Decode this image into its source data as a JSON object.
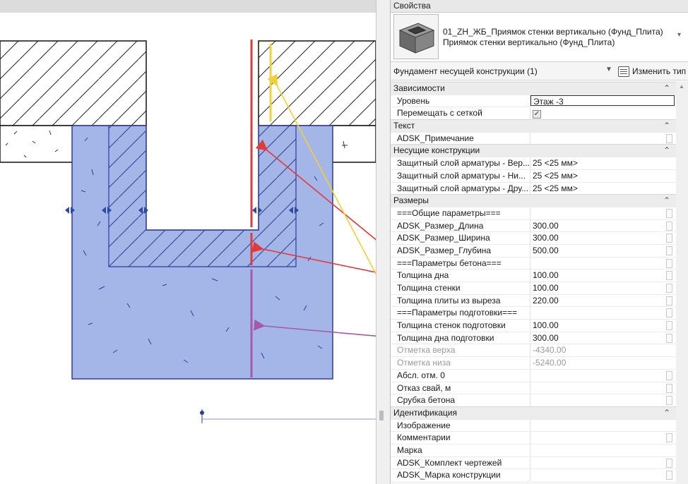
{
  "properties_panel": {
    "title": "Свойства",
    "type_name_line1": "01_ZH_ЖБ_Приямок стенки вертикально (Фунд_Плита)",
    "type_name_line2": "Приямок стенки вертикально (Фунд_Плита)",
    "filter_label": "Фундамент несущей конструкции (1)",
    "edit_type_label": "Изменить тип",
    "groups": [
      {
        "name": "Зависимости",
        "params": [
          {
            "name": "Уровень",
            "value": "Этаж -3",
            "editing": true
          },
          {
            "name": "Перемещать с сеткой",
            "value": "✓",
            "checkbox": true
          }
        ]
      },
      {
        "name": "Текст",
        "params": [
          {
            "name": "ADSK_Примечание",
            "value": "",
            "assoc": true
          }
        ]
      },
      {
        "name": "Несущие конструкции",
        "params": [
          {
            "name": "Защитный слой арматуры - Вер...",
            "value": "25 <25 мм>"
          },
          {
            "name": "Защитный слой арматуры - Ни...",
            "value": "25 <25 мм>"
          },
          {
            "name": "Защитный слой арматуры - Дру...",
            "value": "25 <25 мм>"
          }
        ]
      },
      {
        "name": "Размеры",
        "params": [
          {
            "name": "===Общие параметры===",
            "value": "",
            "assoc": true
          },
          {
            "name": "ADSK_Размер_Длина",
            "value": "300.00",
            "assoc": true
          },
          {
            "name": "ADSK_Размер_Ширина",
            "value": "300.00",
            "assoc": true
          },
          {
            "name": "ADSK_Размер_Глубина",
            "value": "500.00",
            "assoc": true
          },
          {
            "name": "===Параметры бетона===",
            "value": "",
            "assoc": true
          },
          {
            "name": "Толщина дна",
            "value": "100.00",
            "assoc": true
          },
          {
            "name": "Толщина стенки",
            "value": "100.00",
            "assoc": true
          },
          {
            "name": "Толщина плиты из выреза",
            "value": "220.00",
            "assoc": true
          },
          {
            "name": "===Параметры подготовки===",
            "value": "",
            "assoc": true
          },
          {
            "name": "Толщина стенок подготовки",
            "value": "100.00",
            "assoc": true
          },
          {
            "name": "Толщина дна подготовки",
            "value": "300.00",
            "assoc": true
          },
          {
            "name": "Отметка верха",
            "value": "-4340.00",
            "dim": true
          },
          {
            "name": "Отметка низа",
            "value": "-5240.00",
            "dim": true
          },
          {
            "name": "Абсл. отм. 0",
            "value": "",
            "assoc": true
          },
          {
            "name": "Отказ свай, м",
            "value": "",
            "assoc": true
          },
          {
            "name": "Срубка бетона",
            "value": "",
            "assoc": true
          }
        ]
      },
      {
        "name": "Идентификация",
        "params": [
          {
            "name": "Изображение",
            "value": ""
          },
          {
            "name": "Комментарии",
            "value": "",
            "assoc": true
          },
          {
            "name": "Марка",
            "value": ""
          },
          {
            "name": "ADSK_Комплект чертежей",
            "value": "",
            "assoc": true
          },
          {
            "name": "ADSK_Марка конструкции",
            "value": "",
            "assoc": true
          }
        ]
      }
    ]
  },
  "colors": {
    "concrete_fill": "#a4b5e8",
    "concrete_outline": "#2b3c9c",
    "annotation_red": "#e23a3a",
    "annotation_yellow": "#f4cf3a",
    "annotation_purple": "#a45aa6"
  },
  "icons": {
    "type_thumbnail": "concrete-pit-3d-icon",
    "edit_type": "edit-type-icon",
    "collapse": "collapse-chevron-icon"
  }
}
